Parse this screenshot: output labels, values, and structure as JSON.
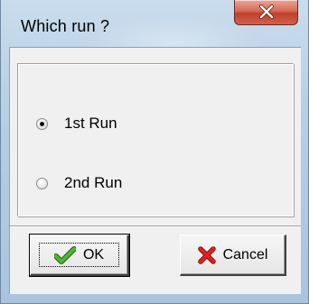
{
  "dialog": {
    "title": "Which run ?"
  },
  "options": [
    {
      "label": "1st Run",
      "selected": true
    },
    {
      "label": "2nd Run",
      "selected": false
    }
  ],
  "buttons": {
    "ok_label": "OK",
    "cancel_label": "Cancel"
  },
  "icons": {
    "close": "close-icon",
    "ok": "checkmark-icon",
    "cancel": "red-x-icon"
  },
  "colors": {
    "close_button": "#c9452f",
    "checkmark": "#3a9a25",
    "cancel_x": "#cc1f1f",
    "dialog_face": "#f0f0f0"
  }
}
